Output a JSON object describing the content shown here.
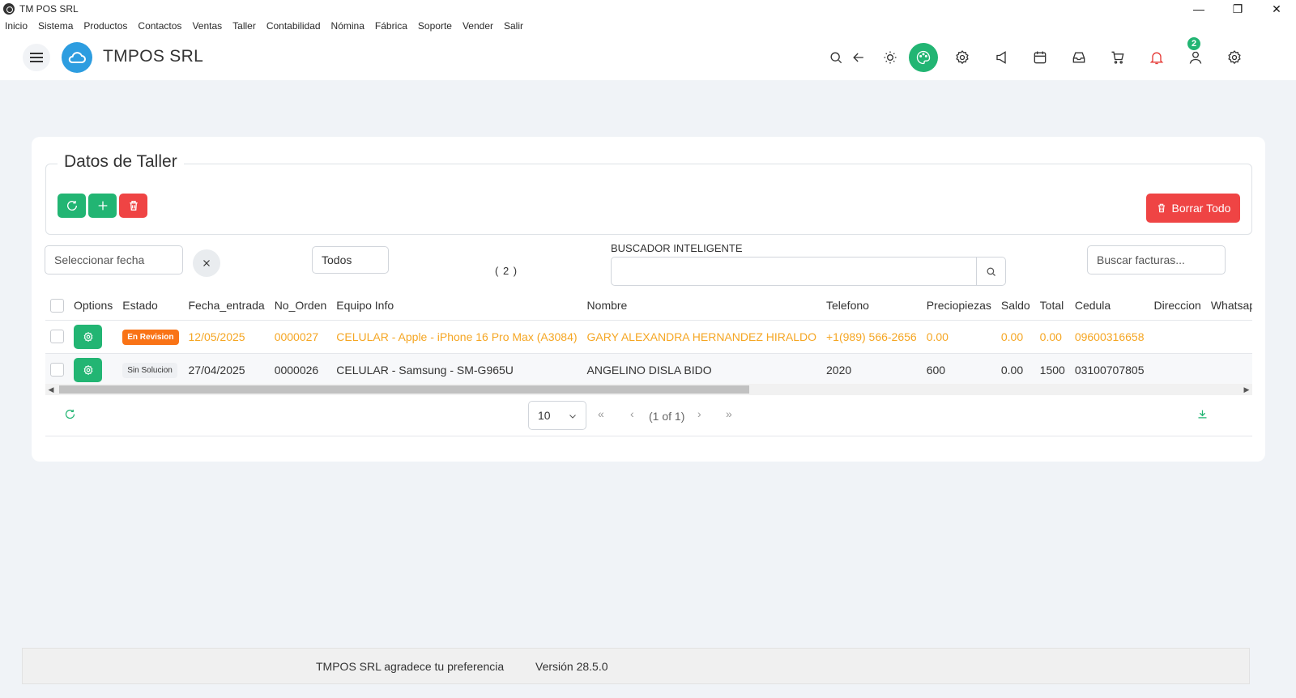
{
  "window": {
    "title": "TM POS SRL",
    "controls": [
      "—",
      "❐",
      "✕"
    ]
  },
  "menu": [
    "Inicio",
    "Sistema",
    "Productos",
    "Contactos",
    "Ventas",
    "Taller",
    "Contabilidad",
    "Nómina",
    "Fábrica",
    "Soporte",
    "Vender",
    "Salir"
  ],
  "header": {
    "brand": "TMPOS SRL",
    "notification_count": "2"
  },
  "card": {
    "title": "Datos de Taller",
    "borrar_label": "Borrar Todo",
    "date_placeholder": "Seleccionar fecha",
    "status_filter": "Todos",
    "record_count": "( 2 )",
    "search_label": "BUSCADOR INTELIGENTE",
    "search_value": "",
    "invoice_placeholder": "Buscar facturas..."
  },
  "table": {
    "headers": [
      "Options",
      "Estado",
      "Fecha_entrada",
      "No_Orden",
      "Equipo Info",
      "Nombre",
      "Telefono",
      "Preciopiezas",
      "Saldo",
      "Total",
      "Cedula",
      "Direccion",
      "Whatsapp"
    ],
    "rows": [
      {
        "estado": "En Revision",
        "fecha": "12/05/2025",
        "orden": "0000027",
        "equipo": "CELULAR - Apple - iPhone 16 Pro Max (A3084)",
        "nombre": "GARY ALEXANDRA HERNANDEZ HIRALDO",
        "telefono": "+1(989) 566-2656",
        "preciopiezas": "0.00",
        "saldo": "0.00",
        "total": "0.00",
        "cedula": "09600316658",
        "direccion": "",
        "whatsapp": ""
      },
      {
        "estado": "Sin Solucion",
        "fecha": "27/04/2025",
        "orden": "0000026",
        "equipo": "CELULAR - Samsung - SM-G965U",
        "nombre": "ANGELINO DISLA BIDO",
        "telefono": "2020",
        "preciopiezas": "600",
        "saldo": "0.00",
        "total": "1500",
        "cedula": "03100707805",
        "direccion": "",
        "whatsapp": ""
      }
    ]
  },
  "pagination": {
    "page_size": "10",
    "page_info": "(1 of 1)"
  },
  "footer": {
    "thanks": "TMPOS SRL agradece tu preferencia",
    "version": "Versión 28.5.0"
  },
  "colors": {
    "accent": "#22b573",
    "danger": "#ef4444",
    "highlight_row": "#f5a623",
    "status_orange": "#f97316",
    "brand_blue": "#2d9de0"
  }
}
